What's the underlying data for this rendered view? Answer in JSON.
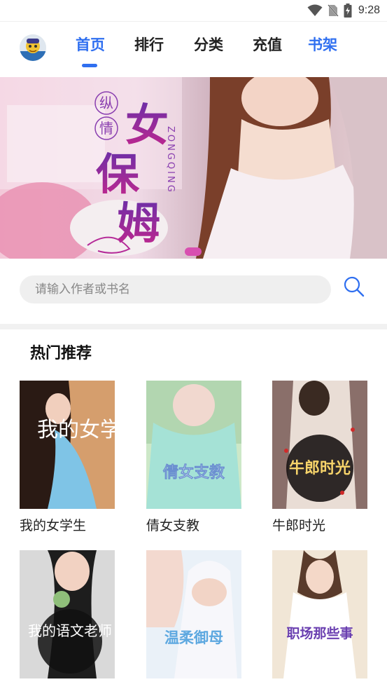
{
  "status_bar": {
    "time": "9:28"
  },
  "nav": {
    "tabs": [
      {
        "label": "首页",
        "active": true
      },
      {
        "label": "排行",
        "active": false
      },
      {
        "label": "分类",
        "active": false
      },
      {
        "label": "充值",
        "active": false
      },
      {
        "label": "书架",
        "active": false
      }
    ]
  },
  "banner": {
    "prefix": [
      "纵",
      "情"
    ],
    "title": [
      "女",
      "保",
      "姆"
    ],
    "pinyin": "ZONGQING"
  },
  "search": {
    "placeholder": "请输入作者或书名"
  },
  "hot": {
    "title": "热门推荐",
    "books": [
      {
        "title": "我的女学生",
        "cover_text": "我的女学生"
      },
      {
        "title": "倩女支教",
        "cover_text": "倩女支教"
      },
      {
        "title": "牛郎时光",
        "cover_text": "牛郎时光"
      },
      {
        "title": "",
        "cover_text": "我的语文老师"
      },
      {
        "title": "",
        "cover_text": "温柔御母"
      },
      {
        "title": "",
        "cover_text": "职场那些事"
      }
    ]
  },
  "colors": {
    "accent": "#2f6ff0",
    "banner_dot": "#d84fb0"
  }
}
